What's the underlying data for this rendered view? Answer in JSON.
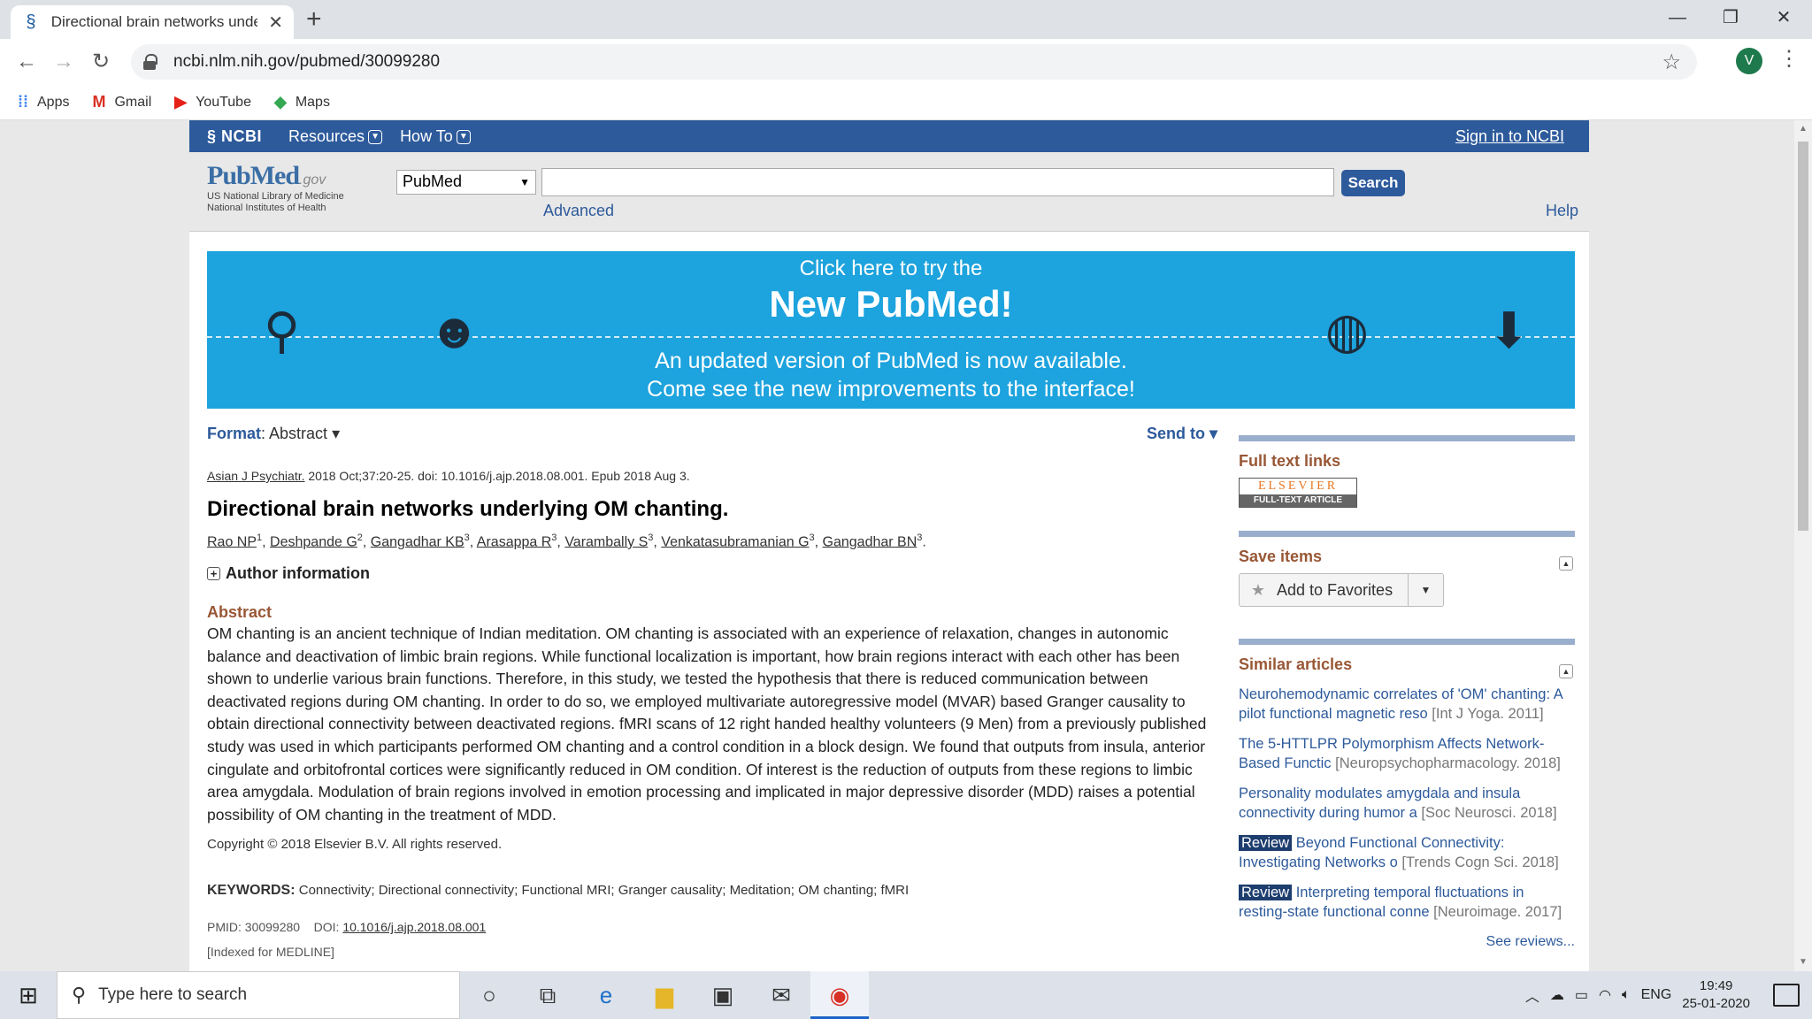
{
  "browser": {
    "tab_title": "Directional brain networks under",
    "url": "ncbi.nlm.nih.gov/pubmed/30099280",
    "avatar_letter": "V",
    "bookmarks": [
      {
        "label": "Apps",
        "icon": "apps-grid-icon"
      },
      {
        "label": "Gmail",
        "icon": "gmail-icon"
      },
      {
        "label": "YouTube",
        "icon": "youtube-icon"
      },
      {
        "label": "Maps",
        "icon": "maps-icon"
      }
    ]
  },
  "ncbi": {
    "logo": "NCBI",
    "menu": [
      "Resources",
      "How To"
    ],
    "signin": "Sign in to NCBI",
    "pubmed_logo_a": "Pub",
    "pubmed_logo_b": "Med",
    "pubmed_logo_gov": ".gov",
    "pubmed_sub1": "US National Library of Medicine",
    "pubmed_sub2": "National Institutes of Health",
    "db_selected": "PubMed",
    "search_value": "",
    "search_button": "Search",
    "advanced": "Advanced",
    "help": "Help"
  },
  "banner": {
    "line1": "Click here to try the",
    "line2": "New PubMed!",
    "line3": "An updated version of PubMed is now available.",
    "line4": "Come see the new improvements to the interface!"
  },
  "article": {
    "format_label": "Format",
    "format_value": "Abstract",
    "send_to": "Send to",
    "journal": "Asian J Psychiatr.",
    "citation_rest": "2018 Oct;37:20-25. doi: 10.1016/j.ajp.2018.08.001. Epub 2018 Aug 3.",
    "title": "Directional brain networks underlying OM chanting.",
    "authors": [
      {
        "name": "Rao NP",
        "sup": "1"
      },
      {
        "name": "Deshpande G",
        "sup": "2"
      },
      {
        "name": "Gangadhar KB",
        "sup": "3"
      },
      {
        "name": "Arasappa R",
        "sup": "3"
      },
      {
        "name": "Varambally S",
        "sup": "3"
      },
      {
        "name": "Venkatasubramanian G",
        "sup": "3"
      },
      {
        "name": "Gangadhar BN",
        "sup": "3"
      }
    ],
    "author_info": "Author information",
    "abstract_heading": "Abstract",
    "abstract": "OM chanting is an ancient technique of Indian meditation. OM chanting is associated with an experience of relaxation, changes in autonomic balance and deactivation of limbic brain regions. While functional localization is important, how brain regions interact with each other has been shown to underlie various brain functions. Therefore, in this study, we tested the hypothesis that there is reduced communication between deactivated regions during OM chanting. In order to do so, we employed multivariate autoregressive model (MVAR) based Granger causality to obtain directional connectivity between deactivated regions. fMRI scans of 12 right handed healthy volunteers (9 Men) from a previously published study was used in which participants performed OM chanting and a control condition in a block design. We found that outputs from insula, anterior cingulate and orbitofrontal cortices were significantly reduced in OM condition. Of interest is the reduction of outputs from these regions to limbic area amygdala. Modulation of brain regions involved in emotion processing and implicated in major depressive disorder (MDD) raises a potential possibility of OM chanting in the treatment of MDD.",
    "copyright": "Copyright © 2018 Elsevier B.V. All rights reserved.",
    "keywords_label": "KEYWORDS:",
    "keywords": "Connectivity; Directional connectivity; Functional MRI; Granger causality; Meditation; OM chanting; fMRI",
    "pmid": "PMID: 30099280",
    "doi_label": "DOI:",
    "doi": "10.1016/j.ajp.2018.08.001",
    "indexed": "[Indexed for MEDLINE]"
  },
  "sidebar": {
    "full_text_heading": "Full text links",
    "elsevier_top": "ELSEVIER",
    "elsevier_bottom": "FULL-TEXT ARTICLE",
    "save_heading": "Save items",
    "add_favorites": "Add to Favorites",
    "similar_heading": "Similar articles",
    "similar": [
      {
        "review": "",
        "title": "Neurohemodynamic correlates of 'OM' chanting: A pilot functional magnetic reso",
        "journal": "[Int J Yoga. 2011]"
      },
      {
        "review": "",
        "title": "The 5-HTTLPR Polymorphism Affects Network-Based Functic",
        "journal": "[Neuropsychopharmacology. 2018]"
      },
      {
        "review": "",
        "title": "Personality modulates amygdala and insula connectivity during humor a",
        "journal": "[Soc Neurosci. 2018]"
      },
      {
        "review": "Review",
        "title": "Beyond Functional Connectivity: Investigating Networks o",
        "journal": "[Trends Cogn Sci. 2018]"
      },
      {
        "review": "Review",
        "title": "Interpreting temporal fluctuations in resting-state functional conne",
        "journal": "[Neuroimage. 2017]"
      }
    ],
    "see_reviews": "See reviews..."
  },
  "taskbar": {
    "search_placeholder": "Type here to search",
    "lang": "ENG",
    "time": "19:49",
    "date": "25-01-2020"
  }
}
